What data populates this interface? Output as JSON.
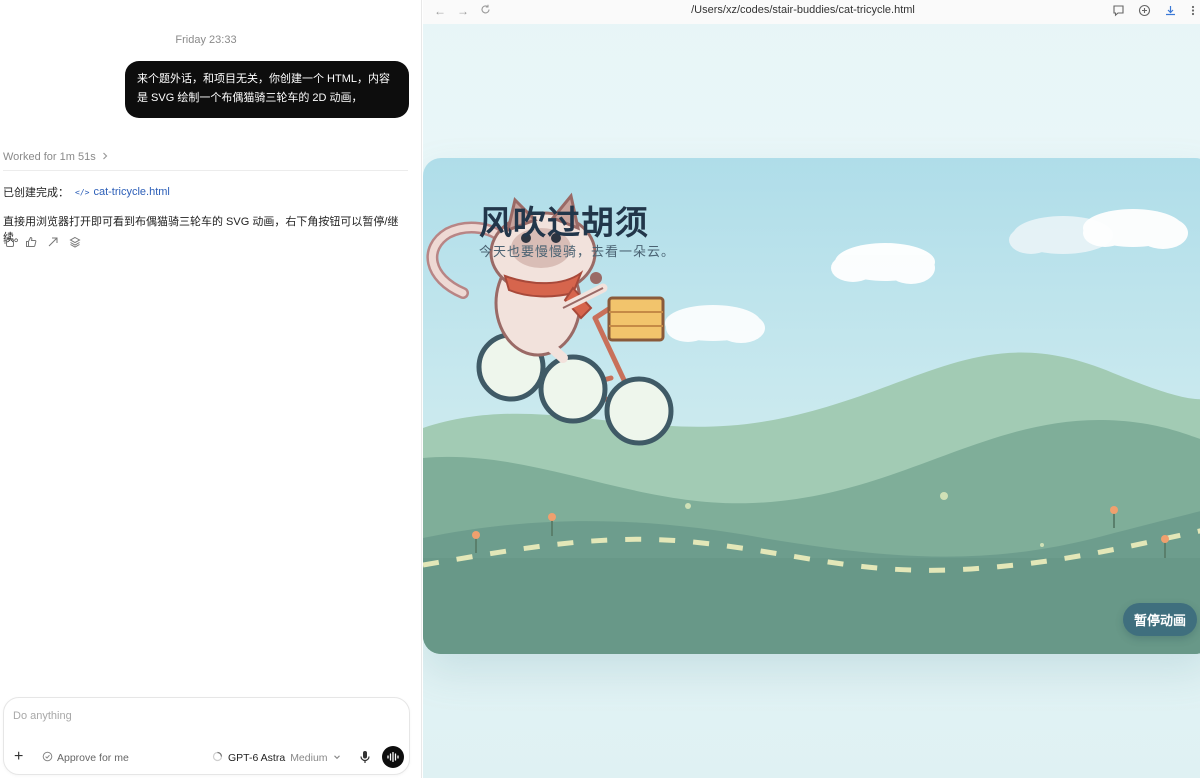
{
  "chat": {
    "timestamp": "Friday 23:33",
    "user_message": "来个题外话，和项目无关，你创建一个 HTML，内容是 SVG 绘制一个布偶猫骑三轮车的 2D 动画，",
    "worked": "Worked for 1m 51s",
    "created_prefix": "已创建完成：",
    "file_name": "cat-tricycle.html",
    "body": "直接用浏览器打开即可看到布偶猫骑三轮车的 SVG 动画，右下角按钮可以暂停/继续。",
    "actions": [
      "copy-icon",
      "thumbs-icon",
      "share-icon",
      "stack-icon"
    ]
  },
  "composer": {
    "placeholder": "Do anything",
    "approve": "Approve for me",
    "model": "GPT-6 Astra",
    "effort": "Medium"
  },
  "browser": {
    "url": "/Users/xz/codes/stair-buddies/cat-tricycle.html",
    "toolbar_icons": [
      "back-icon",
      "forward-icon",
      "reload-icon",
      "comment-icon",
      "add-icon",
      "download-icon",
      "more-icon"
    ]
  },
  "scene": {
    "title": "风吹过胡须",
    "subtitle": "今天也要慢慢骑，去看一朵云。",
    "pause_label": "暂停动画",
    "colors": {
      "sky_top": "#afdde9",
      "hill_back": "#a2cbb4",
      "hill_mid": "#7fae99",
      "hill_front": "#6d9c8c",
      "road_dash": "#e3e7b8",
      "frame": "#d97a5e",
      "wheel": "#3f5a66",
      "scarf": "#d6654d",
      "basket": "#f2c46c"
    }
  }
}
